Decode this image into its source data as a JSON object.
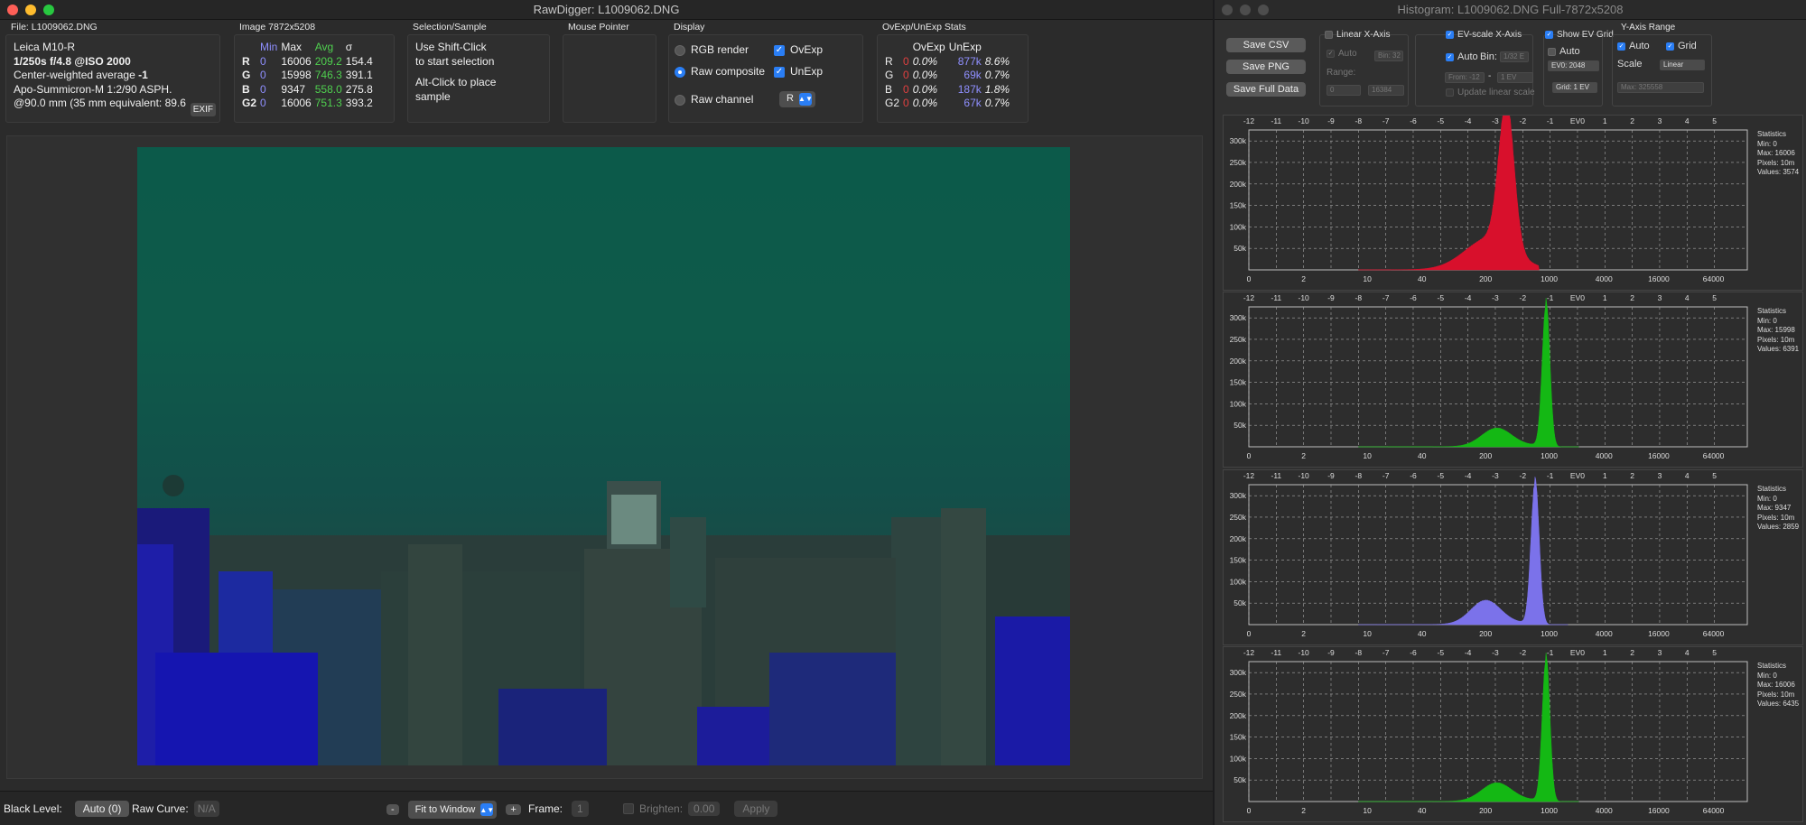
{
  "main": {
    "title": "RawDigger: L1009062.DNG",
    "file_label": "File: L1009062.DNG",
    "camera": {
      "model": "Leica M10-R",
      "exposure": "1/250s f/4.8 @ISO 2000",
      "metering_prefix": "Center-weighted average ",
      "metering_value": "-1",
      "lens": "Apo-Summicron-M 1:2/90 ASPH.",
      "focal": "@90.0 mm (35 mm equivalent: 89.6",
      "exif_button": "EXIF"
    },
    "image": {
      "label": "Image 7872x5208",
      "headers": [
        "",
        "Min",
        "Max",
        "Avg",
        "σ"
      ],
      "rows": [
        {
          "ch": "R",
          "min": "0",
          "max": "16006",
          "avg": "209.2",
          "sd": "154.4"
        },
        {
          "ch": "G",
          "min": "0",
          "max": "15998",
          "avg": "746.3",
          "sd": "391.1"
        },
        {
          "ch": "B",
          "min": "0",
          "max": "9347",
          "avg": "558.0",
          "sd": "275.8"
        },
        {
          "ch": "G2",
          "min": "0",
          "max": "16006",
          "avg": "751.3",
          "sd": "393.2"
        }
      ]
    },
    "selection": {
      "label": "Selection/Sample",
      "line1": "Use Shift-Click",
      "line2": "to start selection",
      "line3": "Alt-Click to place",
      "line4": "sample"
    },
    "mouse": {
      "label": "Mouse Pointer"
    },
    "display": {
      "label": "Display",
      "rgb_render": "RGB render",
      "raw_composite": "Raw composite",
      "raw_channel": "Raw channel",
      "ovexp": "OvExp",
      "unexp": "UnExp",
      "channel_value": "R",
      "selected": "raw_composite"
    },
    "ovexp_stats": {
      "label": "OvExp/UnExp Stats",
      "headers": [
        "",
        "",
        "OvExp",
        "UnExp",
        ""
      ],
      "rows": [
        {
          "ch": "R",
          "n1": "0",
          "p1": "0.0%",
          "n2": "877k",
          "p2": "8.6%"
        },
        {
          "ch": "G",
          "n1": "0",
          "p1": "0.0%",
          "n2": "69k",
          "p2": "0.7%"
        },
        {
          "ch": "B",
          "n1": "0",
          "p1": "0.0%",
          "n2": "187k",
          "p2": "1.8%"
        },
        {
          "ch": "G2",
          "n1": "0",
          "p1": "0.0%",
          "n2": "67k",
          "p2": "0.7%"
        }
      ]
    },
    "bottom": {
      "black_level_label": "Black Level:",
      "black_level_value": "Auto (0)",
      "raw_curve_label": "Raw Curve:",
      "raw_curve_value": "N/A",
      "zoom_minus": "-",
      "zoom_value": "Fit to Window",
      "zoom_plus": "+",
      "frame_label": "Frame:",
      "frame_value": "1",
      "brighten_label": "Brighten:",
      "brighten_value": "0.00",
      "apply": "Apply"
    }
  },
  "histogram": {
    "title": "Histogram: L1009062.DNG Full-7872x5208",
    "buttons": {
      "csv": "Save CSV",
      "png": "Save PNG",
      "full": "Save Full Data"
    },
    "linear_x": {
      "label": "Linear X-Axis",
      "auto": "Auto",
      "bin": "Bin: 32",
      "range": "Range:",
      "from": "0",
      "to": "16384"
    },
    "ev_x": {
      "label": "EV-scale X-Axis",
      "auto": "Auto",
      "bin_label": "Bin:",
      "bin": "1/32 E",
      "from": "From: -12",
      "to": "1 EV",
      "update": "Update linear scale"
    },
    "ev_grid": {
      "label": "Show EV Grid",
      "auto": "Auto",
      "ev0": "EV0: 2048",
      "grid": "Grid: 1 EV"
    },
    "y_axis": {
      "label": "Y-Axis Range",
      "auto": "Auto",
      "grid": "Grid",
      "scale_label": "Scale",
      "scale": "Linear",
      "max": "Max: 325558"
    },
    "ev_ticks": [
      "-12",
      "-11",
      "-10",
      "-9",
      "-8",
      "-7",
      "-6",
      "-5",
      "-4",
      "-3",
      "-2",
      "-1",
      "EV0",
      "1",
      "2",
      "3",
      "4",
      "5"
    ],
    "x_ticks": [
      "0",
      "2",
      "10",
      "40",
      "200",
      "1000",
      "4000",
      "16000",
      "64000"
    ],
    "y_ticks": [
      "300k",
      "250k",
      "200k",
      "150k",
      "100k",
      "50k"
    ],
    "stats_label": "Statistics",
    "channels": [
      {
        "name": "R",
        "color": "#d8102c",
        "min": "Min: 0",
        "max": "Max: 16006",
        "pixels": "Pixels: 10m",
        "values": "Values: 3574",
        "peak_ev": -2.6,
        "peak": 0.82,
        "sigma": 0.28,
        "shoulder": 0.0
      },
      {
        "name": "G",
        "color": "#14b814",
        "min": "Min: 0",
        "max": "Max: 15998",
        "pixels": "Pixels: 10m",
        "values": "Values: 6391",
        "peak_ev": -1.15,
        "peak": 0.97,
        "sigma": 0.14,
        "shoulder": 0.13
      },
      {
        "name": "B",
        "color": "#7b72ea",
        "min": "Min: 0",
        "max": "Max: 9347",
        "pixels": "Pixels: 10m",
        "values": "Values: 2859",
        "peak_ev": -1.55,
        "peak": 0.87,
        "sigma": 0.15,
        "shoulder": 0.17
      },
      {
        "name": "G2",
        "color": "#14b814",
        "min": "Min: 0",
        "max": "Max: 16006",
        "pixels": "Pixels: 10m",
        "values": "Values: 6435",
        "peak_ev": -1.15,
        "peak": 0.97,
        "sigma": 0.14,
        "shoulder": 0.13
      }
    ]
  }
}
